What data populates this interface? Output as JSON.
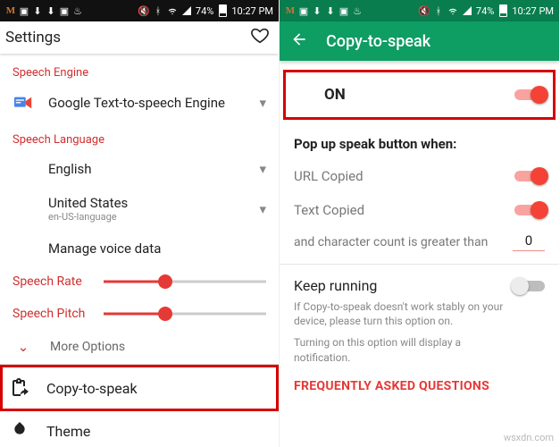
{
  "status": {
    "time": "10:27 PM",
    "battery": "74%"
  },
  "left": {
    "title": "Settings",
    "sections": {
      "engine": "Speech Engine",
      "language": "Speech Language"
    },
    "tts_engine": "Google Text-to-speech Engine",
    "lang": "English",
    "country": "United States",
    "country_sub": "en-US-language",
    "manage": "Manage voice data",
    "rate_label": "Speech Rate",
    "pitch_label": "Speech Pitch",
    "more": "More Options",
    "copy_to_speak": "Copy-to-speak",
    "theme": "Theme"
  },
  "right": {
    "title": "Copy-to-speak",
    "on": "ON",
    "popup_heading": "Pop up speak button when:",
    "url_copied": "URL Copied",
    "text_copied": "Text Copied",
    "char_count_label": "and character count is greater than",
    "char_count_value": "0",
    "keep_running": "Keep running",
    "keep_running_desc1": "If Copy-to-speak doesn't work stably on your device, please turn this option on.",
    "keep_running_desc2": "Turning on this option will display a notification.",
    "faq": "FREQUENTLY ASKED QUESTIONS"
  },
  "watermark": "wsxdn.com"
}
